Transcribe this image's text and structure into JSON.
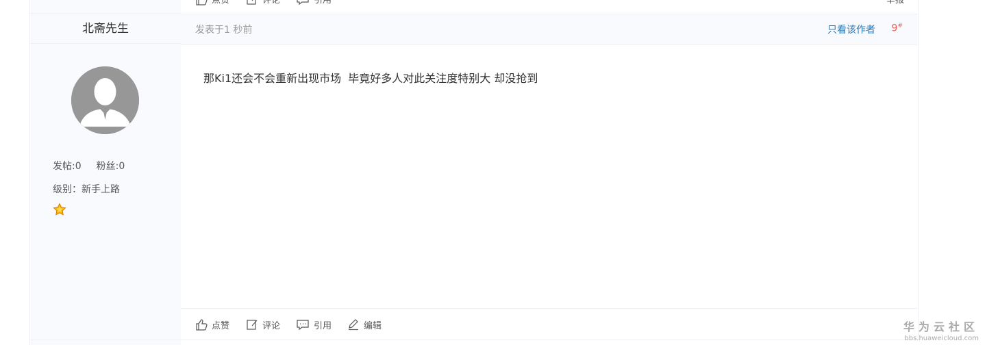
{
  "top_actions": {
    "like_label": "点赞",
    "comment_label": "评论",
    "quote_label": "引用",
    "report_label": "举报"
  },
  "author": {
    "name": "北斋先生",
    "posts_label": "发帖:0",
    "fans_label": "粉丝:0",
    "level_label": "级别：新手上路"
  },
  "post": {
    "time": "发表于1 秒前",
    "only_author_label": "只看该作者",
    "floor_number": "9",
    "floor_mark": "#",
    "content": "那Ki1还会不会重新出现市场  毕竟好多人对此关注度特别大 却没抢到"
  },
  "actions": {
    "like_label": "点赞",
    "comment_label": "评论",
    "quote_label": "引用",
    "edit_label": "编辑"
  },
  "watermark": {
    "title": "华为云社区",
    "url": "bbs.huaweicloud.com"
  },
  "colors": {
    "link": "#2a7ab3",
    "floor": "#f05a5a",
    "sidebar_bg": "#f9fafe",
    "avatar_bg": "#979797"
  }
}
